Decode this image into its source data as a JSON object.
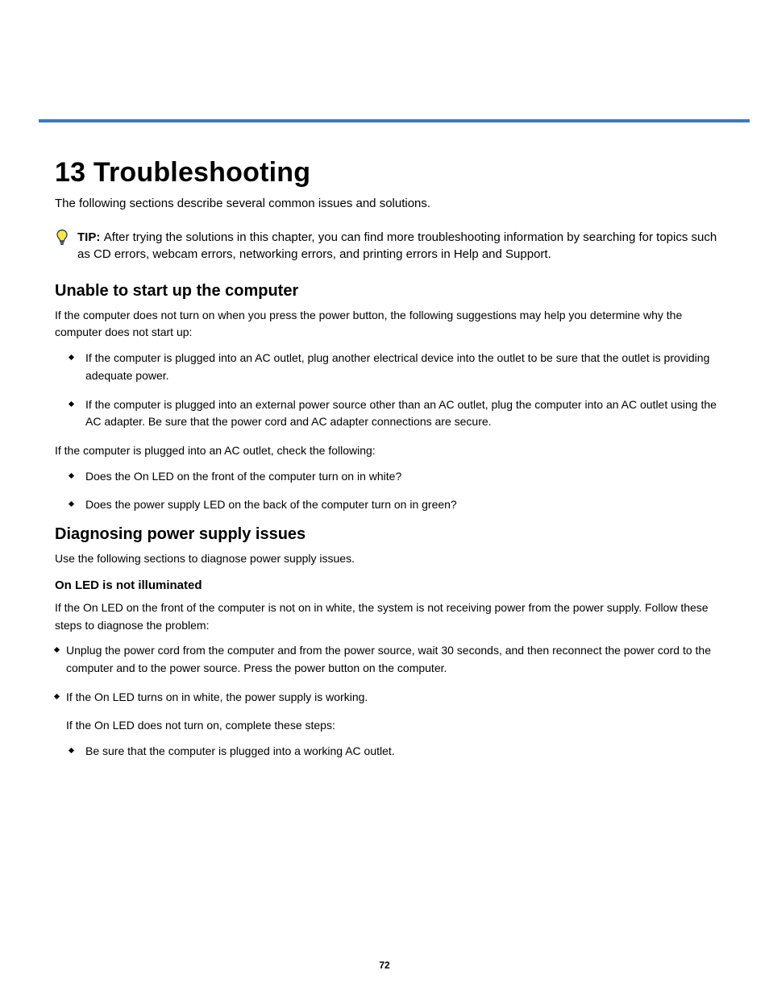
{
  "title": "13 Troubleshooting",
  "lead": "The following sections describe several common issues and solutions.",
  "tip": {
    "label": "TIP:",
    "text": "After trying the solutions in this chapter, you can find more troubleshooting information by searching for topics such as CD errors, webcam errors, networking errors, and printing errors in Help and Support."
  },
  "sections": [
    {
      "heading": "Unable to start up the computer",
      "paragraphs": [
        "If the computer does not turn on when you press the power button, the following suggestions may help you determine why the computer does not start up:"
      ],
      "bullets": [
        "If the computer is plugged into an AC outlet, plug another electrical device into the outlet to be sure that the outlet is providing adequate power.",
        "If the computer is plugged into an external power source other than an AC outlet, plug the computer into an AC outlet using the AC adapter. Be sure that the power cord and AC adapter connections are secure."
      ],
      "sub_paragraph": "If the computer is plugged into an AC outlet, check the following:",
      "sub_bullets": [
        "Does the On LED on the front of the computer turn on in white?",
        "Does the power supply LED on the back of the computer turn on in green?"
      ]
    },
    {
      "heading": "Diagnosing power supply issues",
      "body": "Use the following sections to diagnose power supply issues.",
      "subheading": "On LED is not illuminated",
      "sub_body": "If the On LED on the front of the computer is not on in white, the system is not receiving power from the power supply. Follow these steps to diagnose the problem:",
      "bullets": [
        "Unplug the power cord from the computer and from the power source, wait 30 seconds, and then reconnect the power cord to the computer and to the power source. Press the power button on the computer.",
        "If the On LED turns on in white, the power supply is working."
      ],
      "trailing": "If the On LED does not turn on, complete these steps:",
      "trailing_bullets": [
        "Be sure that the computer is plugged into a working AC outlet."
      ]
    }
  ],
  "page_number": "72"
}
